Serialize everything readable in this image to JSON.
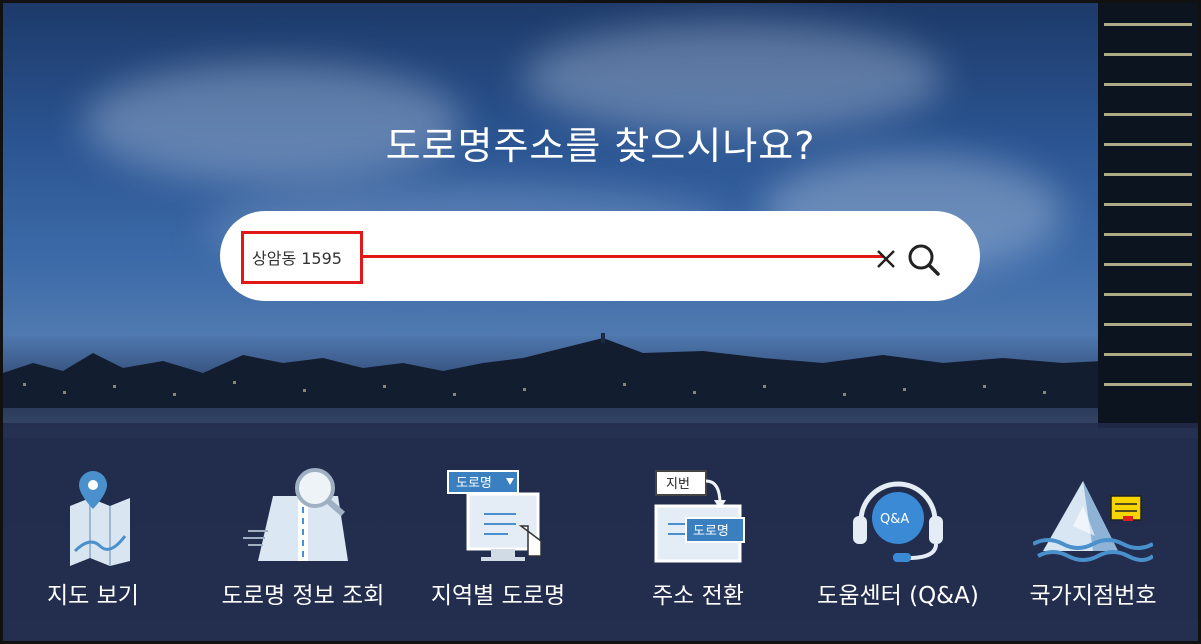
{
  "hero": {
    "title": "도로명주소를 찾으시나요?"
  },
  "search": {
    "value": "상암동 1595",
    "clear_icon": "close-icon",
    "search_icon": "search-icon",
    "highlight_color": "#e01818"
  },
  "menu": {
    "items": [
      {
        "label": "지도 보기",
        "icon": "map-icon"
      },
      {
        "label": "도로명 정보 조회",
        "icon": "road-info-icon"
      },
      {
        "label": "지역별 도로명",
        "icon": "regional-road-icon"
      },
      {
        "label": "주소 전환",
        "icon": "address-convert-icon"
      },
      {
        "label": "도움센터 (Q&A)",
        "icon": "help-center-icon"
      },
      {
        "label": "국가지점번호",
        "icon": "national-point-icon"
      }
    ],
    "icon_badges": {
      "road_name": "도로명",
      "lot_number": "지번",
      "qa": "Q&A"
    }
  }
}
